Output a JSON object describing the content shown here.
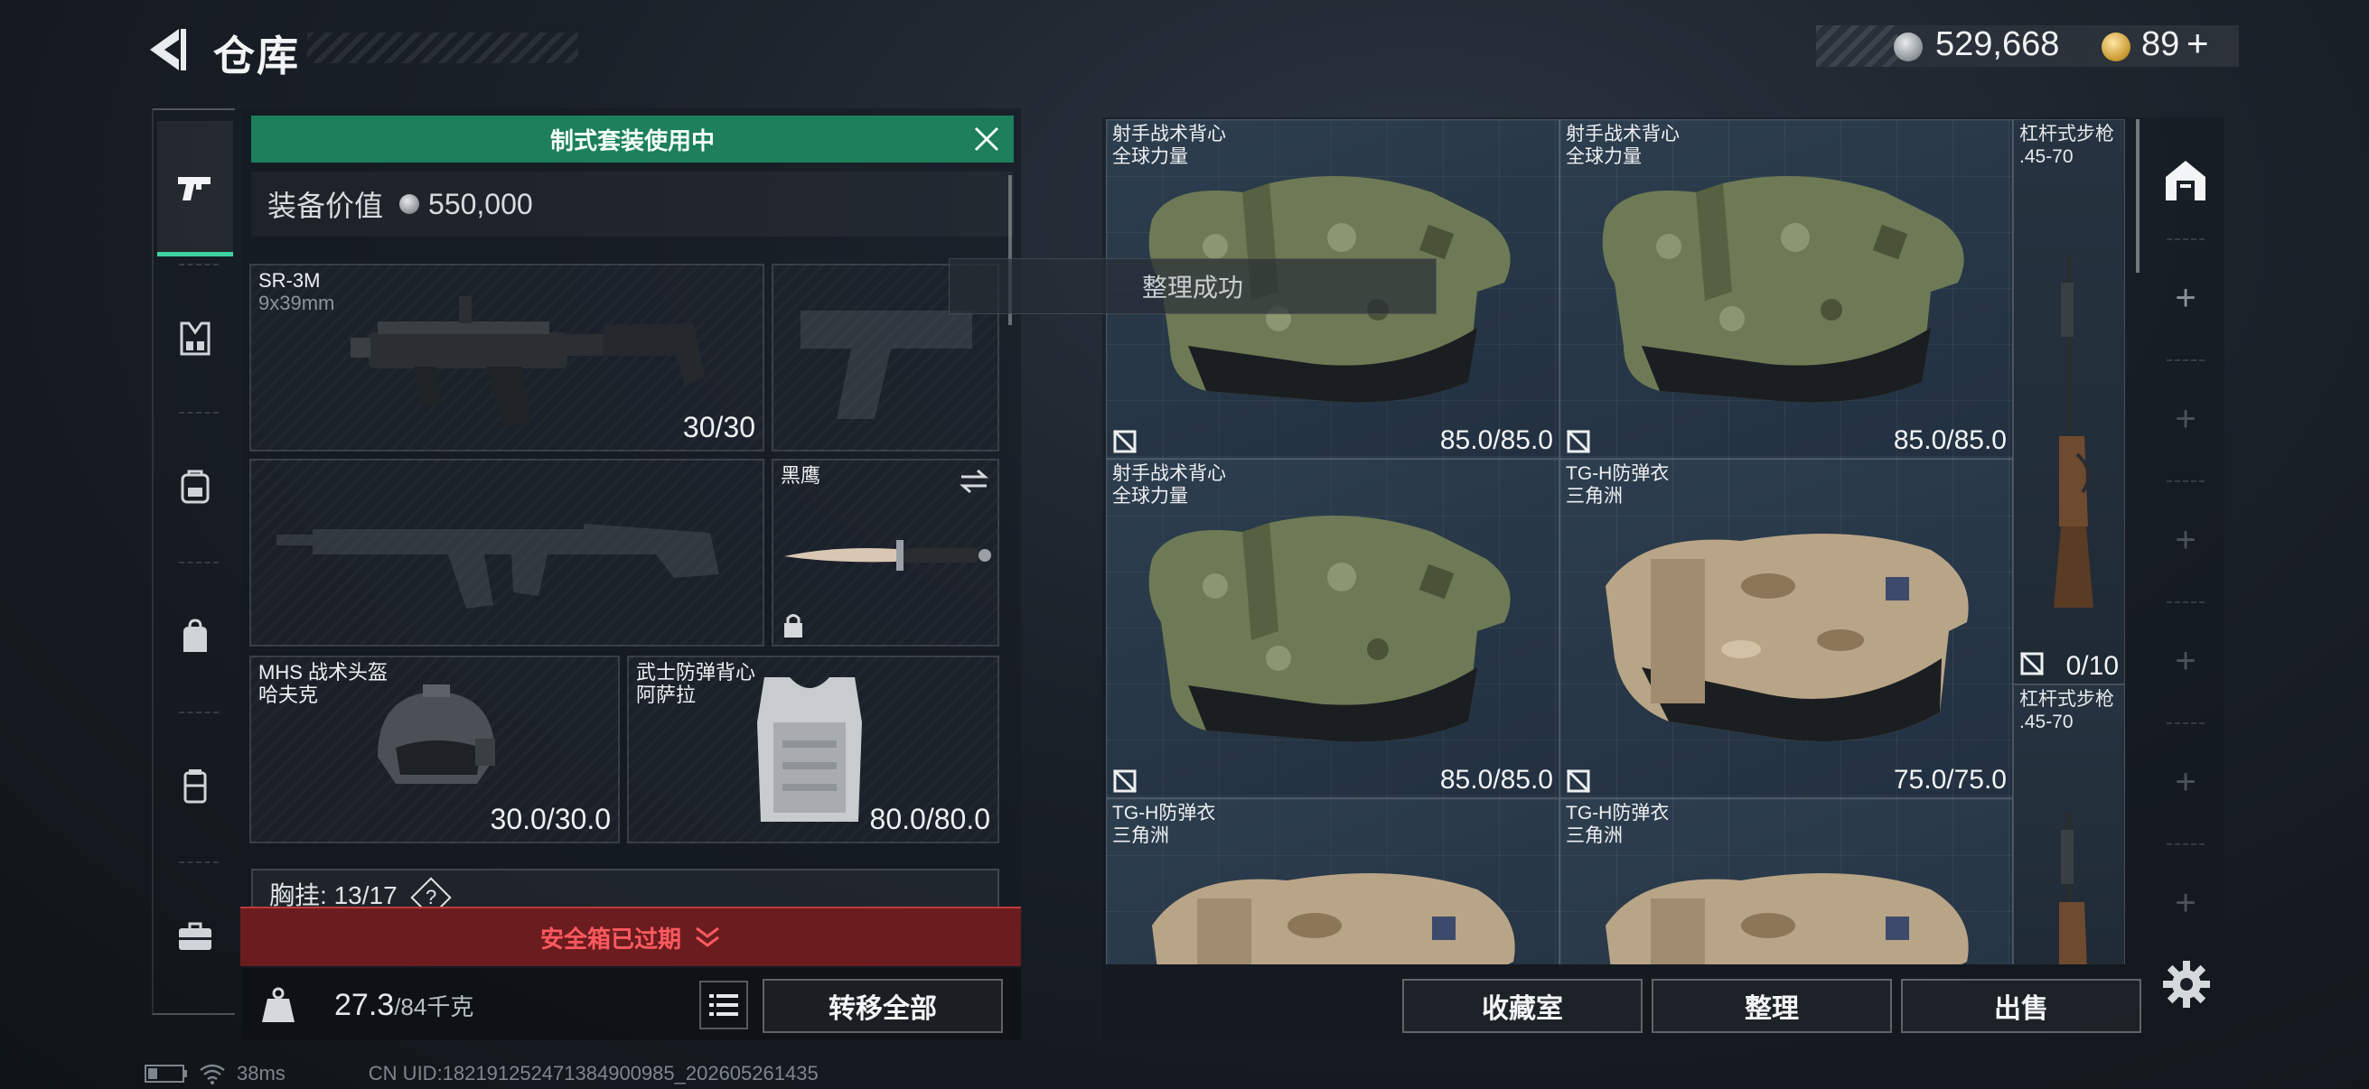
{
  "header": {
    "title": "仓库",
    "silver_amount": "529,668",
    "gold_amount": "89",
    "gold_add": "+"
  },
  "sidebar": {
    "items": [
      {
        "icon": "pistol-icon",
        "active": true
      },
      {
        "icon": "armor-rig-icon"
      },
      {
        "icon": "backpack-icon"
      },
      {
        "icon": "bag-icon"
      },
      {
        "icon": "cylinder-case-icon"
      },
      {
        "icon": "briefcase-icon"
      }
    ]
  },
  "loadout": {
    "banner": "制式套装使用中",
    "value_label": "装备价值",
    "value_amount": "550,000",
    "primary": {
      "name": "SR-3M",
      "sub": "9x39mm",
      "durability": "30/30"
    },
    "melee": {
      "name": "黑鹰"
    },
    "helmet": {
      "name": "MHS 战术头盔",
      "sub": "哈夫克",
      "durability": "30.0/30.0"
    },
    "armor": {
      "name": "武士防弹背心",
      "sub": "阿萨拉",
      "durability": "80.0/80.0"
    },
    "chest_rig": {
      "label": "胸挂:",
      "used": "13",
      "sep": "/",
      "total": "17",
      "help": "?"
    },
    "safebox": "安全箱已过期",
    "weight": {
      "current": "27.3",
      "max": "/84千克"
    },
    "transfer_all": "转移全部"
  },
  "storage": {
    "toast": "整理成功",
    "cells": [
      {
        "name": "射手战术背心",
        "sub": "全球力量",
        "durability": "85.0/85.0"
      },
      {
        "name": "射手战术背心",
        "sub": "全球力量",
        "durability": "85.0/85.0"
      },
      {
        "name": "射手战术背心",
        "sub": "全球力量",
        "durability": "85.0/85.0"
      },
      {
        "name": "TG-H防弹衣",
        "sub": "三角洲",
        "durability": "75.0/75.0"
      },
      {
        "name": "TG-H防弹衣",
        "sub": "三角洲",
        "durability": ""
      },
      {
        "name": "TG-H防弹衣",
        "sub": "三角洲",
        "durability": ""
      }
    ],
    "rifles": [
      {
        "name": "杠杆式步枪",
        "sub": ".45-70",
        "count": "0/10"
      },
      {
        "name": "杠杆式步枪",
        "sub": ".45-70",
        "count": ""
      }
    ],
    "buttons": {
      "collection": "收藏室",
      "sort": "整理",
      "sell": "出售"
    }
  },
  "rail": {
    "items": [
      "+",
      "+",
      "+",
      "+",
      "+",
      "+"
    ]
  },
  "status": {
    "ping": "38ms",
    "uid": "CN UID:18219125247138490​0985_202605261435"
  },
  "colors": {
    "accent_green": "#1d7f5c",
    "alert_red": "#ff5a5f",
    "tab_active": "#3ed2a0"
  }
}
